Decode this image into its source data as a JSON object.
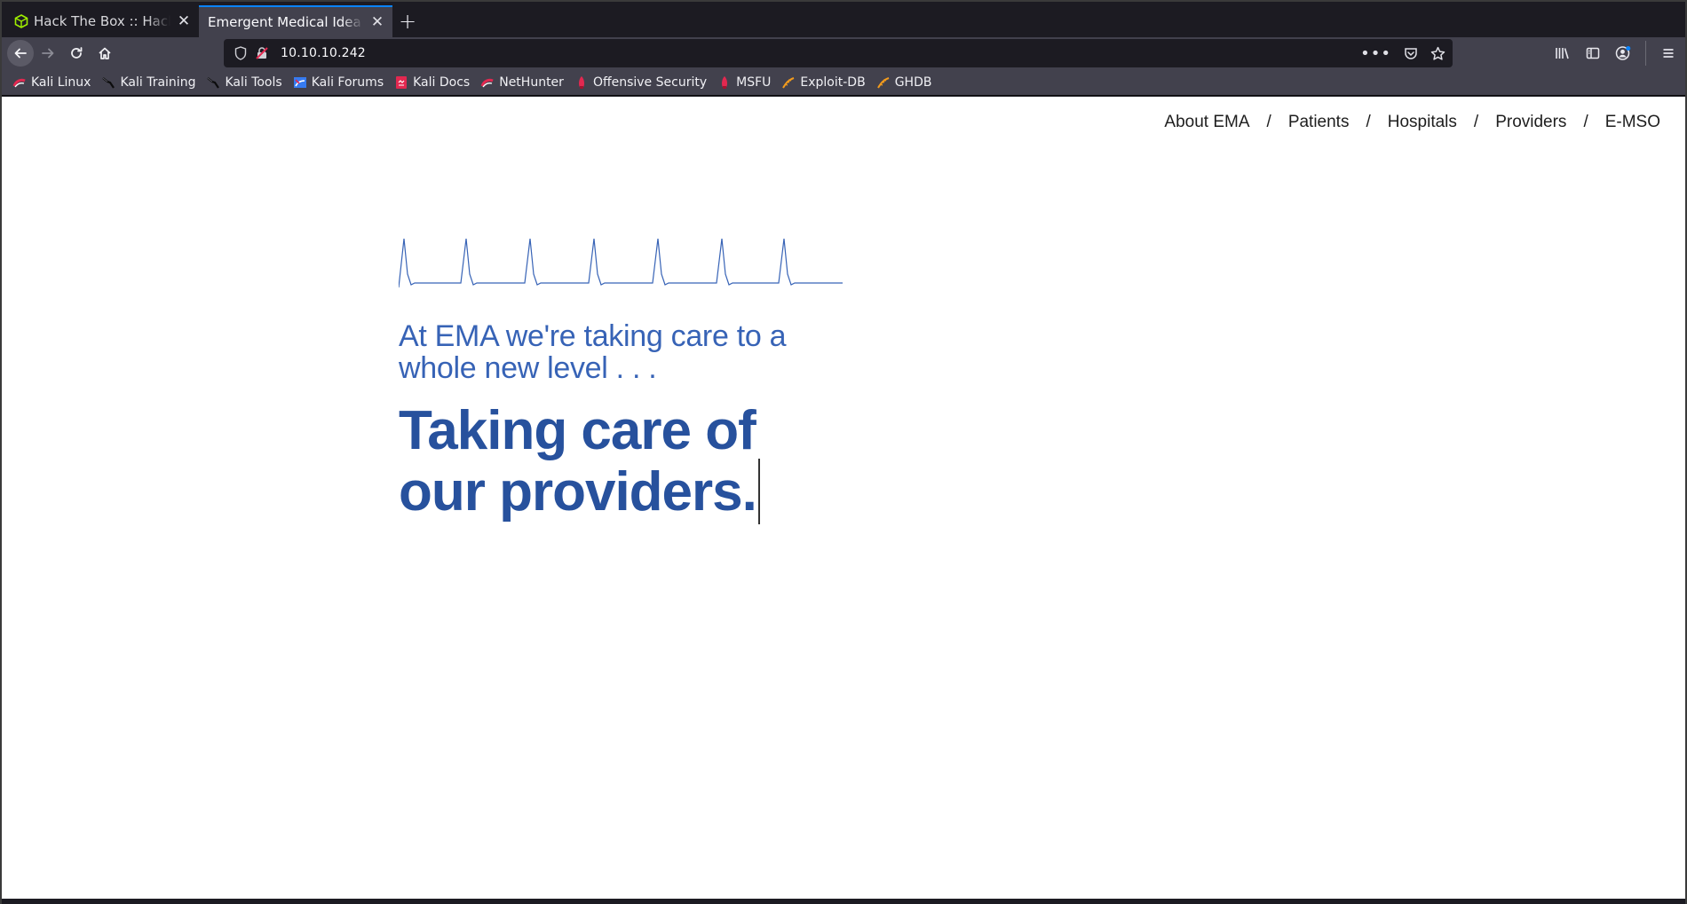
{
  "browser": {
    "tabs": [
      {
        "title": "Hack The Box :: Hack The Box",
        "active": false
      },
      {
        "title": "Emergent Medical Idea",
        "active": true
      }
    ],
    "url": "10.10.10.242",
    "bookmarks": [
      {
        "label": "Kali Linux",
        "icon": "kali-linux-icon"
      },
      {
        "label": "Kali Training",
        "icon": "kali-dragon-icon"
      },
      {
        "label": "Kali Tools",
        "icon": "kali-dragon-icon"
      },
      {
        "label": "Kali Forums",
        "icon": "kali-forums-icon"
      },
      {
        "label": "Kali Docs",
        "icon": "kali-docs-icon"
      },
      {
        "label": "NetHunter",
        "icon": "nethunter-icon"
      },
      {
        "label": "Offensive Security",
        "icon": "offsec-icon"
      },
      {
        "label": "MSFU",
        "icon": "offsec-icon"
      },
      {
        "label": "Exploit-DB",
        "icon": "exploitdb-icon"
      },
      {
        "label": "GHDB",
        "icon": "exploitdb-icon"
      }
    ]
  },
  "site": {
    "nav": [
      "About EMA",
      "Patients",
      "Hospitals",
      "Providers",
      "E-MSO"
    ],
    "separator": "/",
    "tagline": "At EMA we're taking care to a whole new level . . .",
    "headline": "Taking care of our providers."
  },
  "colors": {
    "accent_blue": "#0a84ff",
    "tagline": "#3763b6",
    "headline": "#27519d",
    "ekg_line": "#3763b6"
  }
}
